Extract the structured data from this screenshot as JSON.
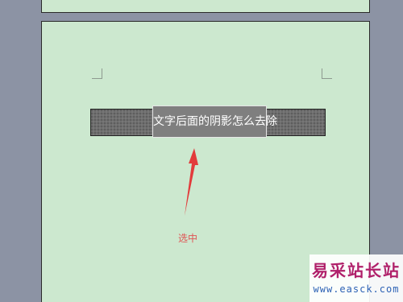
{
  "document": {
    "selected_text": "文字后面的阴影怎么去除",
    "annotation": "选中",
    "highlight_color": "#7f7f7f",
    "shading_color": "#6e6e6e",
    "page_color": "#cce8cf",
    "annotation_color": "#e05454"
  },
  "watermark": {
    "title": "易采站长站",
    "url": "www.easck.com"
  }
}
